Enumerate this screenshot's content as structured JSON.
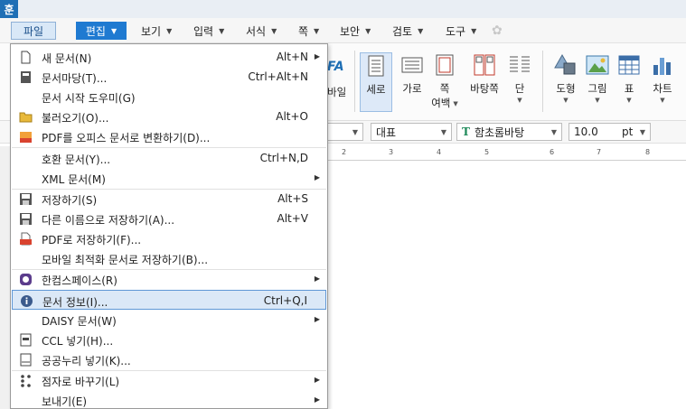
{
  "app": {
    "logo": "훈"
  },
  "menubar": {
    "items": [
      {
        "label": "파일",
        "has_arrow": false
      },
      {
        "label": "편집",
        "has_arrow": true
      },
      {
        "label": "보기",
        "has_arrow": true
      },
      {
        "label": "입력",
        "has_arrow": true
      },
      {
        "label": "서식",
        "has_arrow": true
      },
      {
        "label": "쪽",
        "has_arrow": true
      },
      {
        "label": "보안",
        "has_arrow": true
      },
      {
        "label": "검토",
        "has_arrow": true
      },
      {
        "label": "도구",
        "has_arrow": true
      }
    ]
  },
  "ribbon": {
    "partial_label": "바일",
    "buttons": [
      {
        "label": "세로",
        "icon": "portrait-page-icon",
        "active": true
      },
      {
        "label": "가로",
        "icon": "landscape-page-icon"
      },
      {
        "label": "쪽",
        "sub": "여백",
        "icon": "page-margin-icon"
      },
      {
        "label": "바탕쪽",
        "icon": "master-page-icon"
      },
      {
        "label": "단",
        "icon": "columns-icon"
      },
      {
        "label": "도형",
        "icon": "shapes-icon"
      },
      {
        "label": "그림",
        "icon": "picture-icon"
      },
      {
        "label": "표",
        "icon": "table-icon"
      },
      {
        "label": "차트",
        "icon": "chart-icon"
      }
    ]
  },
  "formatbar": {
    "style": "대표",
    "font": "함초롬바탕",
    "size": "10.0",
    "unit": "pt"
  },
  "ruler": {
    "numbers": [
      "2",
      "3",
      "4",
      "5",
      "6",
      "7",
      "8"
    ]
  },
  "file_menu": {
    "items": [
      {
        "label": "새 문서(N)",
        "shortcut": "Alt+N",
        "submenu": true,
        "icon": "new-document-icon"
      },
      {
        "label": "문서마당(T)...",
        "shortcut": "Ctrl+Alt+N",
        "icon": "template-icon"
      },
      {
        "label": "문서 시작 도우미(G)",
        "shortcut": "",
        "icon": ""
      },
      {
        "label": "불러오기(O)...",
        "shortcut": "Alt+O",
        "icon": "open-folder-icon"
      },
      {
        "label": "PDF를 오피스 문서로 변환하기(D)...",
        "shortcut": "",
        "icon": "pdf-convert-icon"
      },
      {
        "label": "호환 문서(Y)...",
        "shortcut": "Ctrl+N,D",
        "icon": ""
      },
      {
        "label": "XML 문서(M)",
        "shortcut": "",
        "submenu": true,
        "icon": ""
      },
      {
        "label": "저장하기(S)",
        "shortcut": "Alt+S",
        "icon": "save-icon"
      },
      {
        "label": "다른 이름으로 저장하기(A)...",
        "shortcut": "Alt+V",
        "icon": "save-as-icon"
      },
      {
        "label": "PDF로 저장하기(F)...",
        "shortcut": "",
        "icon": "pdf-save-icon"
      },
      {
        "label": "모바일 최적화 문서로 저장하기(B)...",
        "shortcut": "",
        "icon": ""
      },
      {
        "label": "한컴스페이스(R)",
        "shortcut": "",
        "submenu": true,
        "icon": "hancom-space-icon"
      },
      {
        "label": "문서 정보(I)...",
        "shortcut": "Ctrl+Q,I",
        "icon": "info-icon",
        "highlight": true
      },
      {
        "label": "DAISY 문서(W)",
        "shortcut": "",
        "submenu": true,
        "icon": ""
      },
      {
        "label": "CCL 넣기(H)...",
        "shortcut": "",
        "icon": "ccl-icon"
      },
      {
        "label": "공공누리 넣기(K)...",
        "shortcut": "",
        "icon": "kogl-icon"
      },
      {
        "label": "점자로 바꾸기(L)",
        "shortcut": "",
        "submenu": true,
        "icon": "braille-icon"
      },
      {
        "label": "보내기(E)",
        "shortcut": "",
        "submenu": true,
        "icon": ""
      }
    ]
  },
  "colors": {
    "accent": "#1f7ad1",
    "highlight_bg": "#dbe8f7",
    "highlight_border": "#5f97d6"
  }
}
